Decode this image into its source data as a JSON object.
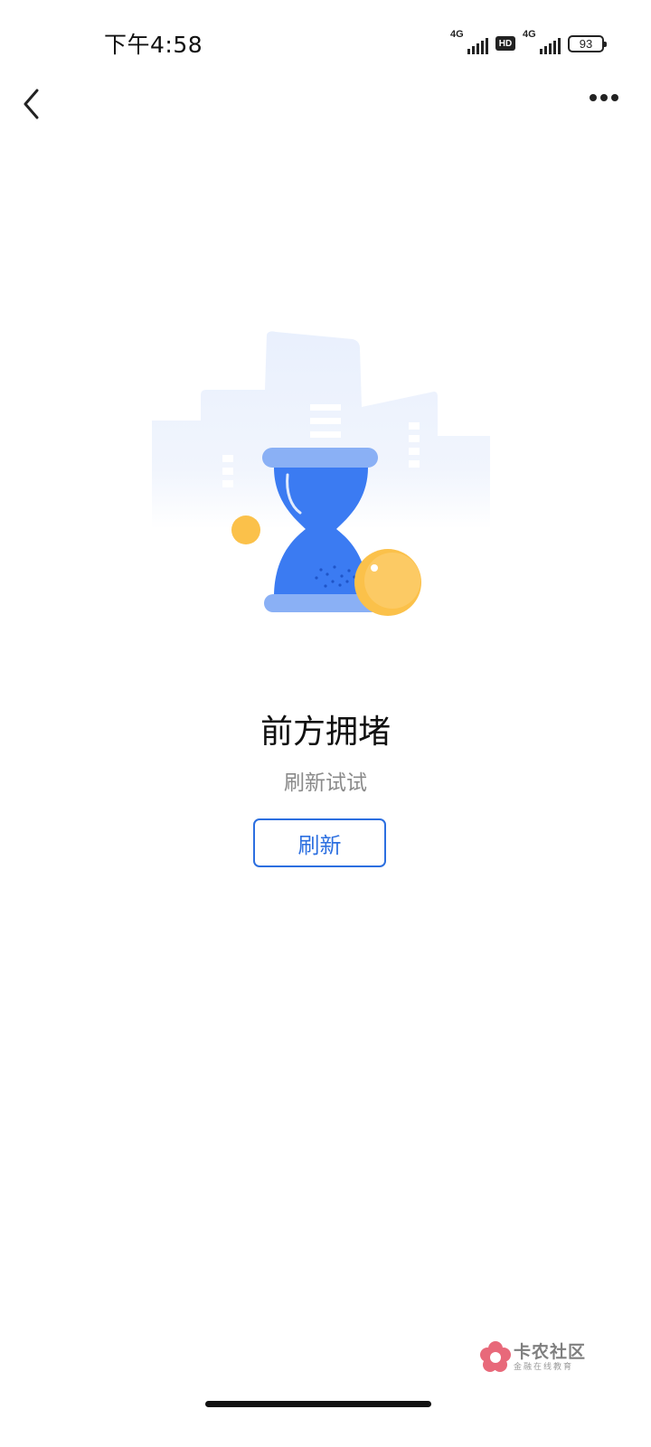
{
  "status_bar": {
    "time": "下午4:58",
    "sim1_label": "4G",
    "hd_label": "HD",
    "sim2_label": "4G",
    "battery": "93"
  },
  "nav": {
    "back_icon": "chevron-left-icon",
    "more_icon": "more-horizontal-icon"
  },
  "error": {
    "illustration": "hourglass-illustration",
    "title": "前方拥堵",
    "subtitle": "刷新试试",
    "refresh_label": "刷新"
  },
  "watermark": {
    "name": "卡农社区",
    "tagline": "金融在线教育"
  },
  "colors": {
    "accent": "#2c6fe0",
    "hourglass_blue": "#3b7bf2",
    "coin_yellow": "#fbc14a"
  }
}
